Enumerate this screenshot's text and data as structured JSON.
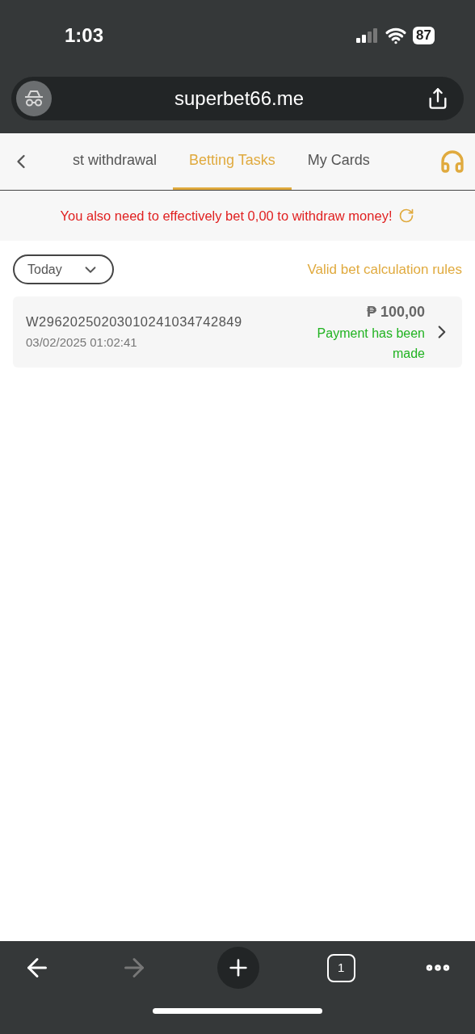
{
  "status_bar": {
    "time": "1:03",
    "battery": "87"
  },
  "browser": {
    "url": "superbet66.me",
    "tab_count": "1",
    "forward_disabled": true
  },
  "tabs": [
    {
      "label": "st withdrawal",
      "selected": false
    },
    {
      "label": "Betting Tasks",
      "selected": true
    },
    {
      "label": "My Cards",
      "selected": false
    }
  ],
  "notice": "You also need to effectively bet 0,00 to withdraw money!",
  "filter": {
    "value": "Today"
  },
  "rules_link": "Valid bet calculation rules",
  "records": [
    {
      "id": "W29620250203010241034742849",
      "date": "03/02/2025 01:02:41",
      "amount": "₱ 100,00",
      "status": "Payment has been made"
    }
  ]
}
